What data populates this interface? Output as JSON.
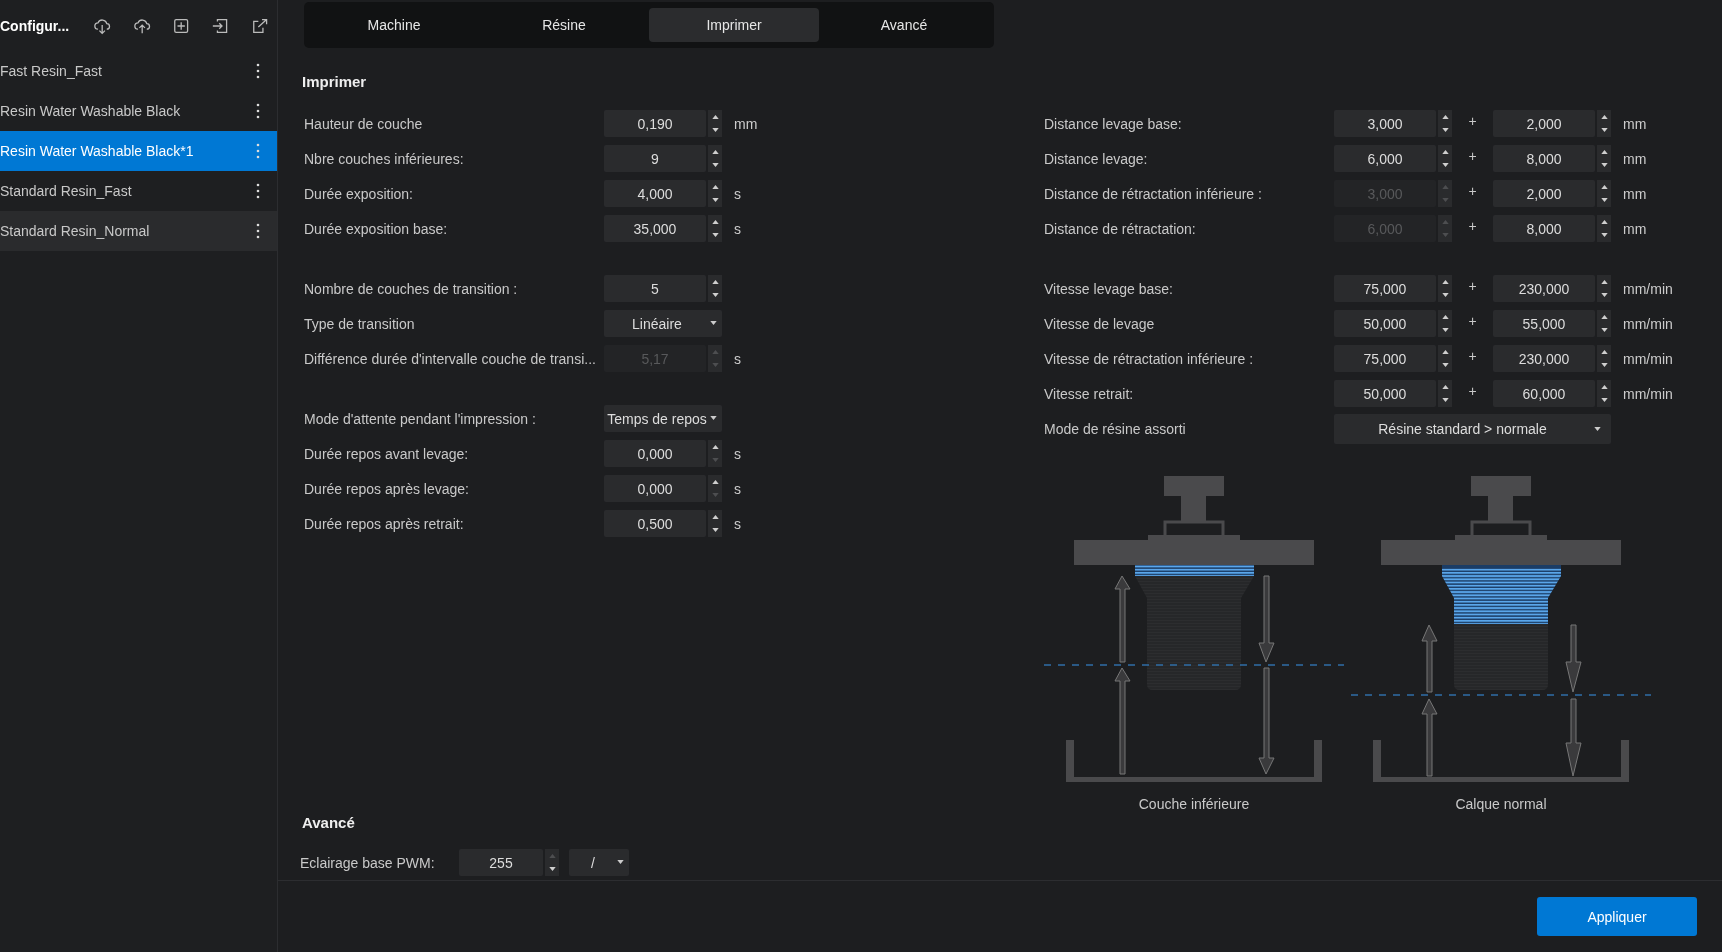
{
  "sidebar": {
    "title": "Configur...",
    "items": [
      {
        "label": "Fast Resin_Fast",
        "selected": false,
        "hovered": false
      },
      {
        "label": "Resin Water Washable Black",
        "selected": false,
        "hovered": false
      },
      {
        "label": "Resin Water Washable Black*1",
        "selected": true,
        "hovered": false
      },
      {
        "label": "Standard Resin_Fast",
        "selected": false,
        "hovered": false
      },
      {
        "label": "Standard Resin_Normal",
        "selected": false,
        "hovered": true
      }
    ]
  },
  "tabs": [
    {
      "label": "Machine",
      "selected": false
    },
    {
      "label": "Résine",
      "selected": false
    },
    {
      "label": "Imprimer",
      "selected": true
    },
    {
      "label": "Avancé",
      "selected": false
    }
  ],
  "print": {
    "title": "Imprimer",
    "left_groups": [
      [
        {
          "kind": "spin",
          "label": "Hauteur de couche",
          "value": "0,190",
          "unit": "mm",
          "disabled": false,
          "up_disabled": false,
          "down_disabled": false
        },
        {
          "kind": "spin",
          "label": "Nbre couches inférieures:",
          "value": "9",
          "disabled": false,
          "up_disabled": false,
          "down_disabled": false
        },
        {
          "kind": "spin",
          "label": "Durée exposition:",
          "value": "4,000",
          "unit": "s",
          "disabled": false,
          "up_disabled": false,
          "down_disabled": false
        },
        {
          "kind": "spin",
          "label": "Durée exposition base:",
          "value": "35,000",
          "unit": "s",
          "disabled": false,
          "up_disabled": false,
          "down_disabled": false
        }
      ],
      [
        {
          "kind": "spin",
          "label": "Nombre de couches de transition :",
          "value": "5",
          "disabled": false,
          "up_disabled": false,
          "down_disabled": false
        },
        {
          "kind": "select",
          "label": "Type de transition",
          "value": "Linéaire"
        },
        {
          "kind": "spin",
          "label": "Différence durée d'intervalle couche de transi...",
          "value": "5,17",
          "unit": "s",
          "disabled": true,
          "up_disabled": true,
          "down_disabled": true
        }
      ],
      [
        {
          "kind": "select",
          "label": "Mode d'attente pendant l'impression :",
          "value": "Temps de repos"
        },
        {
          "kind": "spin",
          "label": "Durée repos avant levage:",
          "value": "0,000",
          "unit": "s",
          "disabled": false,
          "up_disabled": false,
          "down_disabled": true
        },
        {
          "kind": "spin",
          "label": "Durée repos après levage:",
          "value": "0,000",
          "unit": "s",
          "disabled": false,
          "up_disabled": false,
          "down_disabled": true
        },
        {
          "kind": "spin",
          "label": "Durée repos après retrait:",
          "value": "0,500",
          "unit": "s",
          "disabled": false,
          "up_disabled": false,
          "down_disabled": false
        }
      ]
    ],
    "right_groups": [
      [
        {
          "kind": "pair",
          "label": "Distance levage base:",
          "fields": [
            {
              "value": "3,000",
              "disabled": false
            },
            {
              "value": "2,000",
              "disabled": false
            }
          ],
          "separator": "+",
          "unit": "mm"
        },
        {
          "kind": "pair",
          "label": "Distance levage:",
          "fields": [
            {
              "value": "6,000",
              "disabled": false
            },
            {
              "value": "8,000",
              "disabled": false
            }
          ],
          "separator": "+",
          "unit": "mm"
        },
        {
          "kind": "pair",
          "label": "Distance de rétractation inférieure :",
          "fields": [
            {
              "value": "3,000",
              "disabled": true
            },
            {
              "value": "2,000",
              "disabled": false
            }
          ],
          "separator": "+",
          "unit": "mm"
        },
        {
          "kind": "pair",
          "label": "Distance de rétractation:",
          "fields": [
            {
              "value": "6,000",
              "disabled": true
            },
            {
              "value": "8,000",
              "disabled": false
            }
          ],
          "separator": "+",
          "unit": "mm"
        }
      ],
      [
        {
          "kind": "pair",
          "label": "Vitesse levage base:",
          "fields": [
            {
              "value": "75,000",
              "disabled": false
            },
            {
              "value": "230,000",
              "disabled": false
            }
          ],
          "separator": "+",
          "unit": "mm/min"
        },
        {
          "kind": "pair",
          "label": "Vitesse de levage",
          "fields": [
            {
              "value": "50,000",
              "disabled": false
            },
            {
              "value": "55,000",
              "disabled": false
            }
          ],
          "separator": "+",
          "unit": "mm/min"
        },
        {
          "kind": "pair",
          "label": "Vitesse de rétractation inférieure :",
          "fields": [
            {
              "value": "75,000",
              "disabled": false
            },
            {
              "value": "230,000",
              "disabled": false
            }
          ],
          "separator": "+",
          "unit": "mm/min"
        },
        {
          "kind": "pair",
          "label": "Vitesse retrait:",
          "fields": [
            {
              "value": "50,000",
              "disabled": false
            },
            {
              "value": "60,000",
              "disabled": false
            }
          ],
          "separator": "+",
          "unit": "mm/min"
        },
        {
          "kind": "wide_select",
          "label": "Mode de résine assorti",
          "value": "Résine standard > normale"
        }
      ]
    ],
    "diagrams": [
      {
        "kind": "bottom",
        "caption": "Couche inférieure"
      },
      {
        "kind": "normal",
        "caption": "Calque normal"
      }
    ]
  },
  "advanced": {
    "title": "Avancé",
    "rows": [
      {
        "label": "Eclairage base PWM:",
        "value": "255",
        "up_disabled": true,
        "down_disabled": false,
        "option": "/"
      }
    ]
  },
  "apply_button": "Appliquer"
}
